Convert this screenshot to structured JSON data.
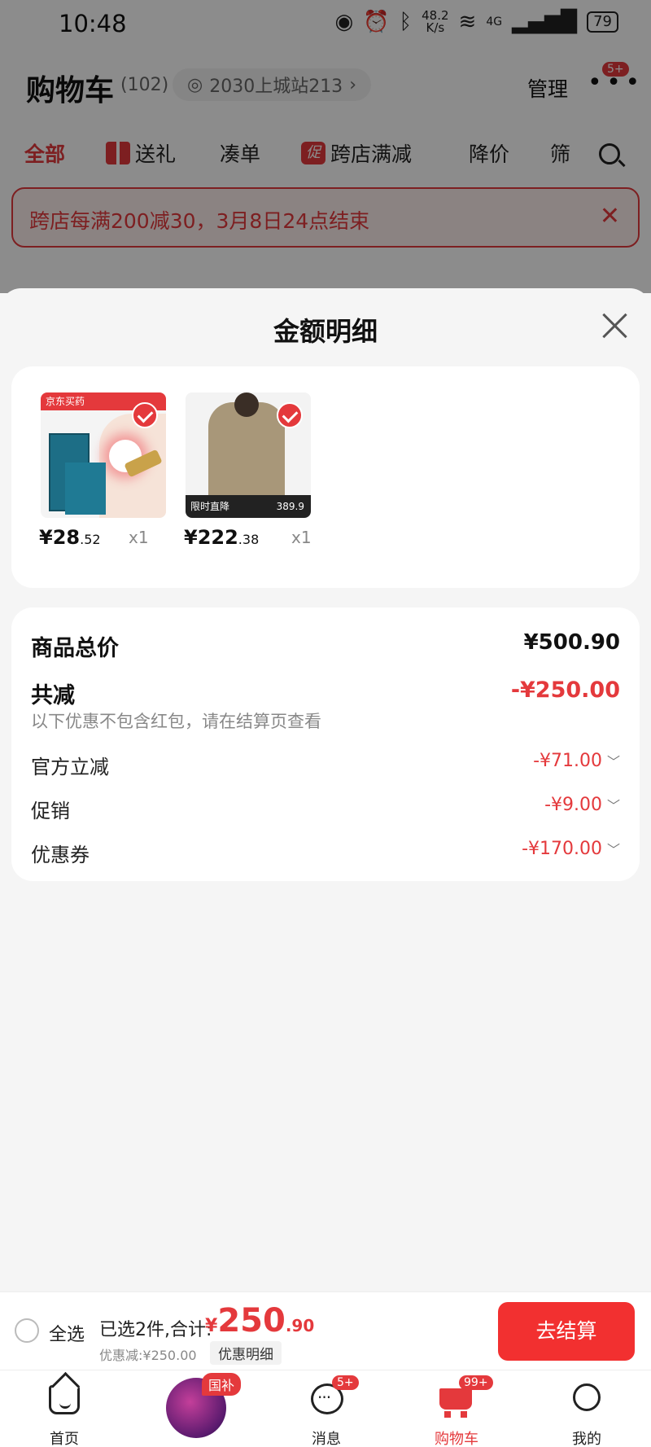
{
  "status_bar": {
    "time": "10:48",
    "speed_value": "48.2",
    "speed_unit": "K/s",
    "network": "4G",
    "battery": "79",
    "icons": [
      "eye-icon",
      "alarm-icon",
      "bluetooth-icon",
      "wifi-icon",
      "signal-icon",
      "battery-icon"
    ]
  },
  "header": {
    "title": "购物车",
    "count": "(102)",
    "location": "2030上城站213",
    "manage": "管理",
    "more_badge": "5+"
  },
  "filters": {
    "all": "全部",
    "gift": "送礼",
    "combine": "凑单",
    "cross_store_icon": "促",
    "cross_store": "跨店满减",
    "price_drop": "降价",
    "filter": "筛"
  },
  "promo_banner": {
    "text": "跨店每满200减30，3月8日24点结束"
  },
  "sheet": {
    "title": "金额明细",
    "products": [
      {
        "thumb_brand": "京东买药",
        "price_int": "¥28",
        "price_dec": ".52",
        "qty": "x1"
      },
      {
        "thumb_tag": "限时直降",
        "thumb_price": "389.9",
        "price_int": "¥222",
        "price_dec": ".38",
        "qty": "x1"
      }
    ],
    "summary": {
      "total_label": "商品总价",
      "total_value": "¥500.90",
      "reduce_label": "共减",
      "reduce_value": "-¥250.00",
      "reduce_note": "以下优惠不包含红包，请在结算页查看",
      "items": [
        {
          "label": "官方立减",
          "value": "-¥71.00"
        },
        {
          "label": "促销",
          "value": "-¥9.00"
        },
        {
          "label": "优惠券",
          "value": "-¥170.00"
        }
      ]
    }
  },
  "checkout": {
    "select_all": "全选",
    "selected_text": "已选2件,合计:",
    "currency": "¥",
    "total_int": "250",
    "total_dec": ".90",
    "discount_note": "优惠减:¥250.00",
    "detail_button": "优惠明细",
    "checkout_button": "去结算"
  },
  "tabbar": {
    "home": "首页",
    "promo_badge": "国补",
    "messages": "消息",
    "messages_badge": "5+",
    "cart": "购物车",
    "cart_badge": "99+",
    "me": "我的"
  },
  "colors": {
    "accent": "#e4393c",
    "checkout_button": "#f23030"
  }
}
